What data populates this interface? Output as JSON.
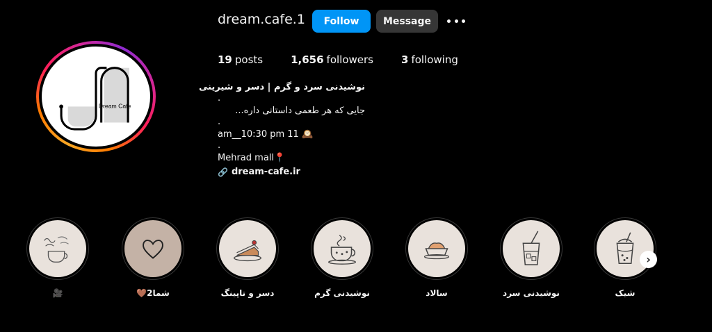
{
  "profile": {
    "username": "dream.cafe.1",
    "follow_label": "Follow",
    "message_label": "Message",
    "avatar_logo_text": "Dream Cafe"
  },
  "stats": {
    "posts_count": "19",
    "posts_label": "posts",
    "followers_count": "1,656",
    "followers_label": "followers",
    "following_count": "3",
    "following_label": "following"
  },
  "bio": {
    "title": "نوشیدنی سرد و گرم | دسر و شیرینی",
    "dot1": ".",
    "tagline": "جایی که هر طعمی داستانی داره...",
    "dot2": ".",
    "hours": "am__10:30 pm 11 🕰️",
    "dot3": ".",
    "location": "Mehrad mall📍",
    "link": "dream-cafe.ir"
  },
  "highlights": [
    {
      "label": "🎥",
      "icon": "coffee-cup-lettering-icon"
    },
    {
      "label": "شما2🤎",
      "icon": "heart-icon"
    },
    {
      "label": "دسر و تاپینگ",
      "icon": "cake-slice-icon"
    },
    {
      "label": "نوشیدنی گرم",
      "icon": "hot-drink-icon"
    },
    {
      "label": "سالاد",
      "icon": "bowl-icon"
    },
    {
      "label": "نوشیدنی سرد",
      "icon": "iced-drink-icon"
    },
    {
      "label": "شیک",
      "icon": "shake-cup-icon"
    }
  ],
  "colors": {
    "background": "#000000",
    "follow_button": "#0095f6",
    "message_button": "#363636",
    "highlight_fill": "#e9e2dc",
    "highlight_fill_alt": "#c4b2a6"
  }
}
